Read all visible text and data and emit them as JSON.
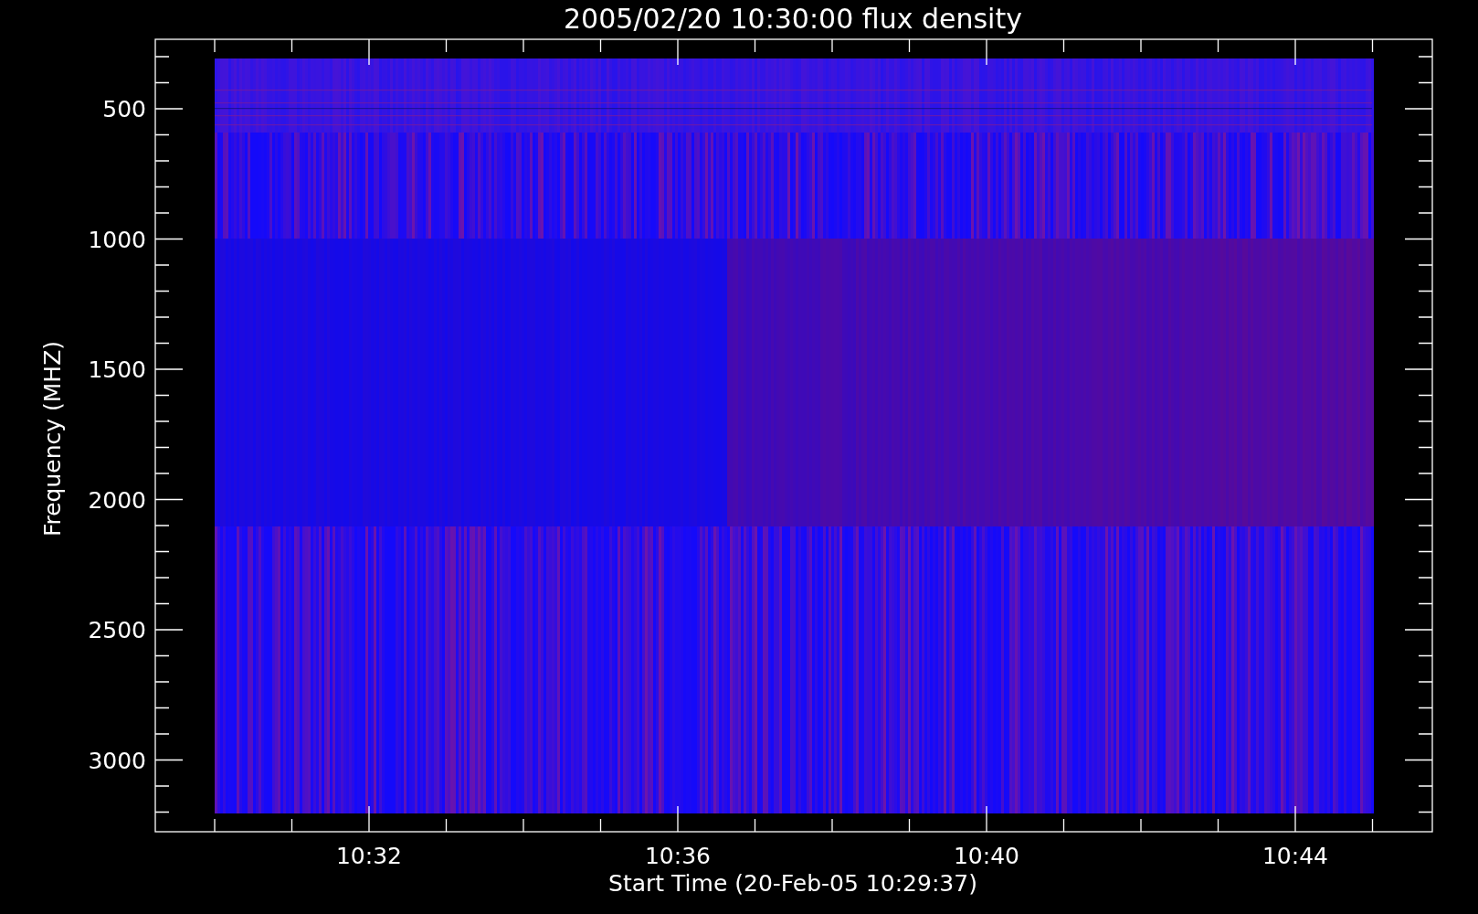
{
  "title": "2005/02/20 10:30:00 flux density",
  "y_axis": {
    "label": "Frequency (MHZ)",
    "ticks": [
      "500",
      "1000",
      "1500",
      "2000",
      "2500",
      "3000"
    ]
  },
  "x_axis": {
    "label": "Start Time (20-Feb-05 10:29:37)",
    "ticks": [
      "10:32",
      "10:36",
      "10:40",
      "10:44"
    ]
  }
}
